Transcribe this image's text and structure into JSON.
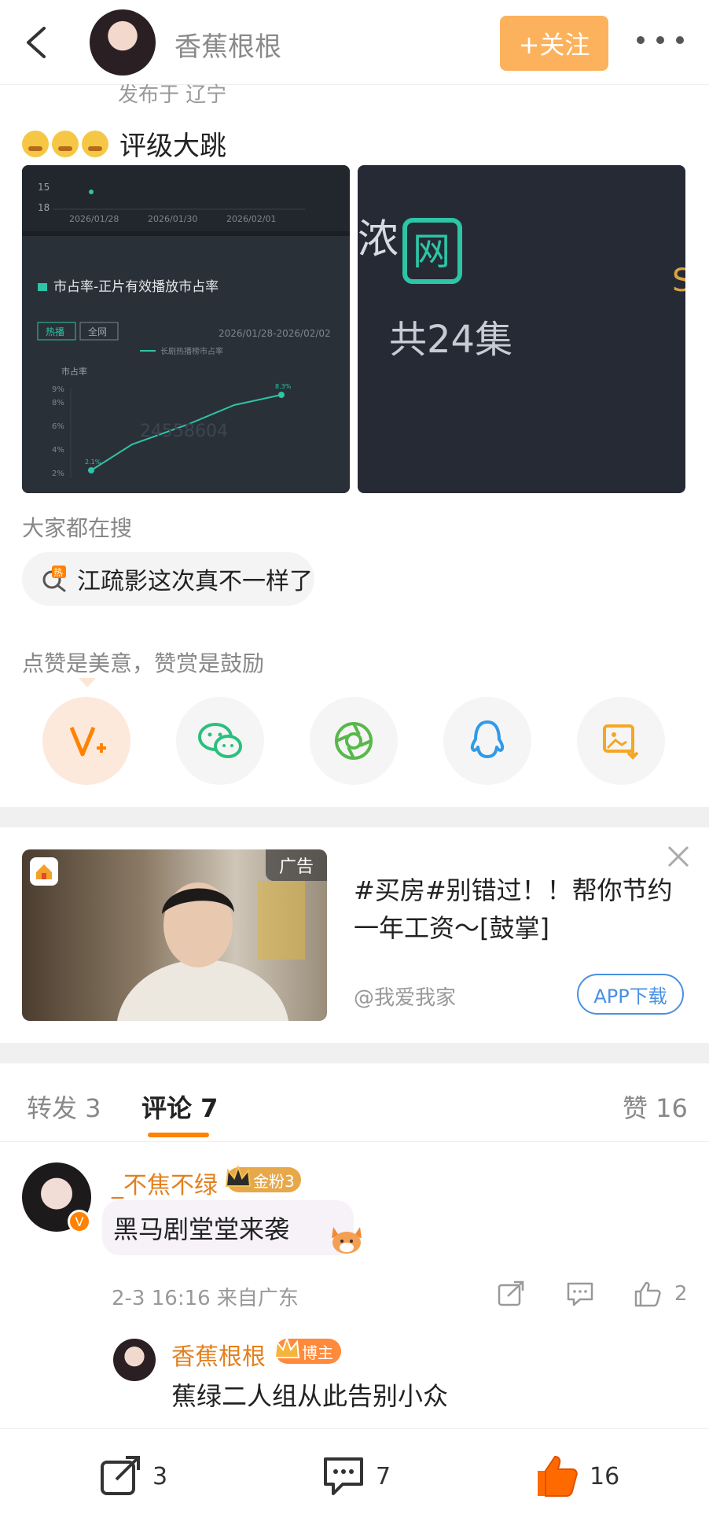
{
  "header": {
    "user_name": "香蕉根根",
    "follow_label": "+关注"
  },
  "post": {
    "publish_location": "发布于 辽宁",
    "text": "评级大跳",
    "emoji_icon": "anxious-face-emoji",
    "left_image": {
      "section_title": "市占率-正片有效播放市占率",
      "tags": [
        "热播",
        "全网"
      ],
      "date_range": "2026/01/28-2026/02/02",
      "legend": "长剧热播榜市占率",
      "y_label": "市占率",
      "y_ticks": [
        "9%",
        "8%",
        "6%",
        "4%",
        "2%"
      ],
      "top_x_ticks": [
        "2026/01/28",
        "2026/01/30",
        "2026/02/01"
      ],
      "top_y_ticks": [
        "15",
        "18"
      ],
      "start_value": "2.1%",
      "end_value": "8.3%",
      "watermark": "24558604"
    },
    "right_image": {
      "label": "网",
      "episodes": "共24集"
    }
  },
  "search": {
    "title": "大家都在搜",
    "chip": "江疏影这次真不一样了",
    "chip_badge": "热"
  },
  "share": {
    "tip": "点赞是美意，赞赏是鼓励",
    "buttons": [
      {
        "icon": "reward-v-plus-icon"
      },
      {
        "icon": "wechat-icon"
      },
      {
        "icon": "moments-icon"
      },
      {
        "icon": "qq-icon"
      },
      {
        "icon": "save-image-icon"
      }
    ]
  },
  "ad": {
    "tag": "广告",
    "text": "#买房#别错过！！帮你节约一年工资～[鼓掌]",
    "source": "@我爱我家",
    "button": "APP下载"
  },
  "tabs": {
    "repost": "转发 3",
    "comment": "评论 7",
    "like": "赞 16"
  },
  "comment": {
    "user": "_不焦不绿",
    "fan_badge": "金粉3",
    "text": "黑马剧堂堂来袭",
    "time_location": "2-3 16:16  来自广东",
    "likes": "2",
    "reply": {
      "user": "香蕉根根",
      "badge": "博主",
      "text": "蕉绿二人组从此告别小众"
    }
  },
  "bottom_bar": {
    "repost_count": "3",
    "comment_count": "7",
    "like_count": "16"
  },
  "colors": {
    "accent": "#ff8200",
    "follow_button": "#fcb25c",
    "chart_line": "#2ec4a6",
    "ad_button": "#4a90e2"
  }
}
